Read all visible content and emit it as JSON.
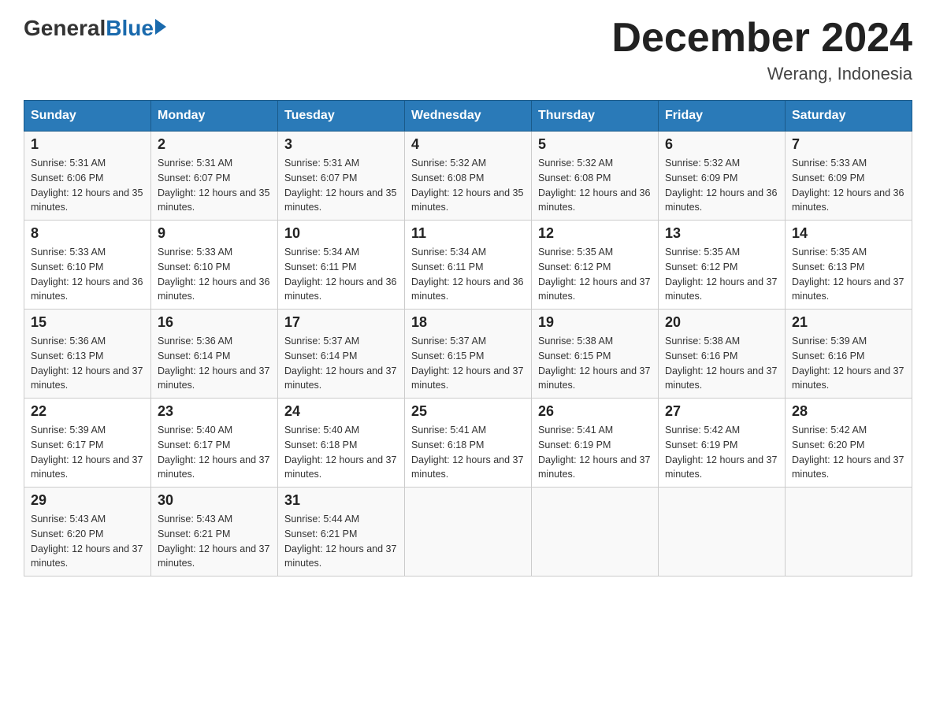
{
  "header": {
    "logo_general": "General",
    "logo_blue": "Blue",
    "month_title": "December 2024",
    "location": "Werang, Indonesia"
  },
  "days_of_week": [
    "Sunday",
    "Monday",
    "Tuesday",
    "Wednesday",
    "Thursday",
    "Friday",
    "Saturday"
  ],
  "weeks": [
    [
      {
        "day": "1",
        "sunrise": "5:31 AM",
        "sunset": "6:06 PM",
        "daylight": "12 hours and 35 minutes."
      },
      {
        "day": "2",
        "sunrise": "5:31 AM",
        "sunset": "6:07 PM",
        "daylight": "12 hours and 35 minutes."
      },
      {
        "day": "3",
        "sunrise": "5:31 AM",
        "sunset": "6:07 PM",
        "daylight": "12 hours and 35 minutes."
      },
      {
        "day": "4",
        "sunrise": "5:32 AM",
        "sunset": "6:08 PM",
        "daylight": "12 hours and 35 minutes."
      },
      {
        "day": "5",
        "sunrise": "5:32 AM",
        "sunset": "6:08 PM",
        "daylight": "12 hours and 36 minutes."
      },
      {
        "day": "6",
        "sunrise": "5:32 AM",
        "sunset": "6:09 PM",
        "daylight": "12 hours and 36 minutes."
      },
      {
        "day": "7",
        "sunrise": "5:33 AM",
        "sunset": "6:09 PM",
        "daylight": "12 hours and 36 minutes."
      }
    ],
    [
      {
        "day": "8",
        "sunrise": "5:33 AM",
        "sunset": "6:10 PM",
        "daylight": "12 hours and 36 minutes."
      },
      {
        "day": "9",
        "sunrise": "5:33 AM",
        "sunset": "6:10 PM",
        "daylight": "12 hours and 36 minutes."
      },
      {
        "day": "10",
        "sunrise": "5:34 AM",
        "sunset": "6:11 PM",
        "daylight": "12 hours and 36 minutes."
      },
      {
        "day": "11",
        "sunrise": "5:34 AM",
        "sunset": "6:11 PM",
        "daylight": "12 hours and 36 minutes."
      },
      {
        "day": "12",
        "sunrise": "5:35 AM",
        "sunset": "6:12 PM",
        "daylight": "12 hours and 37 minutes."
      },
      {
        "day": "13",
        "sunrise": "5:35 AM",
        "sunset": "6:12 PM",
        "daylight": "12 hours and 37 minutes."
      },
      {
        "day": "14",
        "sunrise": "5:35 AM",
        "sunset": "6:13 PM",
        "daylight": "12 hours and 37 minutes."
      }
    ],
    [
      {
        "day": "15",
        "sunrise": "5:36 AM",
        "sunset": "6:13 PM",
        "daylight": "12 hours and 37 minutes."
      },
      {
        "day": "16",
        "sunrise": "5:36 AM",
        "sunset": "6:14 PM",
        "daylight": "12 hours and 37 minutes."
      },
      {
        "day": "17",
        "sunrise": "5:37 AM",
        "sunset": "6:14 PM",
        "daylight": "12 hours and 37 minutes."
      },
      {
        "day": "18",
        "sunrise": "5:37 AM",
        "sunset": "6:15 PM",
        "daylight": "12 hours and 37 minutes."
      },
      {
        "day": "19",
        "sunrise": "5:38 AM",
        "sunset": "6:15 PM",
        "daylight": "12 hours and 37 minutes."
      },
      {
        "day": "20",
        "sunrise": "5:38 AM",
        "sunset": "6:16 PM",
        "daylight": "12 hours and 37 minutes."
      },
      {
        "day": "21",
        "sunrise": "5:39 AM",
        "sunset": "6:16 PM",
        "daylight": "12 hours and 37 minutes."
      }
    ],
    [
      {
        "day": "22",
        "sunrise": "5:39 AM",
        "sunset": "6:17 PM",
        "daylight": "12 hours and 37 minutes."
      },
      {
        "day": "23",
        "sunrise": "5:40 AM",
        "sunset": "6:17 PM",
        "daylight": "12 hours and 37 minutes."
      },
      {
        "day": "24",
        "sunrise": "5:40 AM",
        "sunset": "6:18 PM",
        "daylight": "12 hours and 37 minutes."
      },
      {
        "day": "25",
        "sunrise": "5:41 AM",
        "sunset": "6:18 PM",
        "daylight": "12 hours and 37 minutes."
      },
      {
        "day": "26",
        "sunrise": "5:41 AM",
        "sunset": "6:19 PM",
        "daylight": "12 hours and 37 minutes."
      },
      {
        "day": "27",
        "sunrise": "5:42 AM",
        "sunset": "6:19 PM",
        "daylight": "12 hours and 37 minutes."
      },
      {
        "day": "28",
        "sunrise": "5:42 AM",
        "sunset": "6:20 PM",
        "daylight": "12 hours and 37 minutes."
      }
    ],
    [
      {
        "day": "29",
        "sunrise": "5:43 AM",
        "sunset": "6:20 PM",
        "daylight": "12 hours and 37 minutes."
      },
      {
        "day": "30",
        "sunrise": "5:43 AM",
        "sunset": "6:21 PM",
        "daylight": "12 hours and 37 minutes."
      },
      {
        "day": "31",
        "sunrise": "5:44 AM",
        "sunset": "6:21 PM",
        "daylight": "12 hours and 37 minutes."
      },
      null,
      null,
      null,
      null
    ]
  ]
}
